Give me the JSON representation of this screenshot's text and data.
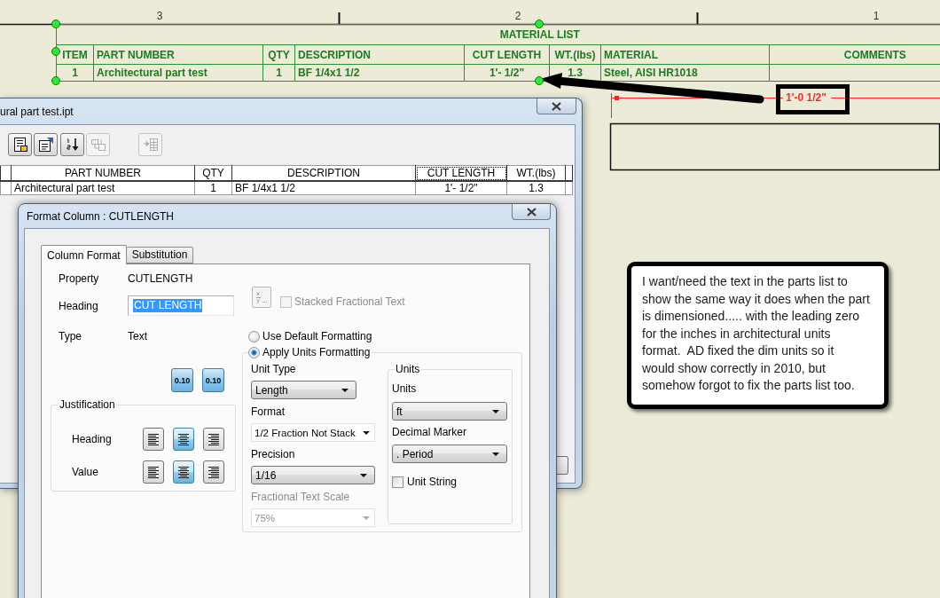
{
  "sheet": {
    "zone_labels": [
      "3",
      "2",
      "1"
    ],
    "material_list": {
      "title": "MATERIAL LIST",
      "columns": [
        "ITEM",
        "PART NUMBER",
        "QTY",
        "DESCRIPTION",
        "CUT LENGTH",
        "WT.(lbs)",
        "MATERIAL",
        "COMMENTS"
      ],
      "rows": [
        [
          "1",
          "Architectural part test",
          "1",
          "BF 1/4x1 1/2",
          "1'- 1/2\"",
          "1.3",
          "Steel, AISI HR1018"
        ]
      ]
    },
    "dimension": {
      "value": "1'-0 1/2\""
    }
  },
  "callout": {
    "text": "I want/need the text in the parts list to\nshow the same way it does when the part\nis dimensioned..... with the leading zero\nfor the inches in architectural units\nformat.  AD fixed the dim units so it\nwould show correctly in 2010, but\nsomehow forgot to fix the parts list too."
  },
  "parts_list_window": {
    "title": "ural part test.ipt",
    "toolbar": [
      {
        "kind": "table",
        "disabled": false
      },
      {
        "kind": "properties",
        "disabled": false
      },
      {
        "kind": "sort",
        "disabled": false
      },
      {
        "kind": "merge",
        "disabled": true
      },
      {
        "kind": "export",
        "disabled": true
      }
    ],
    "table": {
      "columns": [
        {
          "label": "PART NUMBER",
          "selected": false
        },
        {
          "label": "QTY",
          "selected": false
        },
        {
          "label": "DESCRIPTION",
          "selected": false
        },
        {
          "label": "CUT LENGTH",
          "selected": true
        },
        {
          "label": "WT.(lbs)",
          "selected": false
        }
      ],
      "rows": [
        [
          "Architectural part test",
          "1",
          "BF 1/4x1 1/2",
          "1'- 1/2\"",
          "1.3"
        ]
      ]
    }
  },
  "format_column_dialog": {
    "title": "Format Column : CUTLENGTH",
    "tabs": [
      {
        "label": "Column Format",
        "selected": true
      },
      {
        "label": "Substitution",
        "selected": false
      }
    ],
    "fields": [
      {
        "label": "Property",
        "value": "CUTLENGTH",
        "kind": "text"
      },
      {
        "label": "Heading",
        "value": "CUT LENGTH",
        "kind": "input"
      },
      {
        "label": "Type",
        "value": "Text",
        "kind": "text"
      }
    ],
    "precision_buttons": [
      {
        "label": "0.10"
      },
      {
        "label": "0.10"
      }
    ],
    "stacked_fractional_text": {
      "label": "Stacked Fractional Text",
      "checked": false,
      "disabled": true
    },
    "formatting": [
      {
        "label": "Use Default Formatting",
        "selected": false
      },
      {
        "label": "Apply Units Formatting",
        "selected": true
      }
    ],
    "justification": {
      "title": "Justification",
      "rows": [
        {
          "label": "Heading",
          "options": [
            {
              "kind": "left",
              "selected": false
            },
            {
              "kind": "center",
              "selected": true
            },
            {
              "kind": "right",
              "selected": false
            }
          ]
        },
        {
          "label": "Value",
          "options": [
            {
              "kind": "left",
              "selected": false
            },
            {
              "kind": "center",
              "selected": true
            },
            {
              "kind": "right",
              "selected": false
            }
          ]
        }
      ]
    },
    "unit_fields": [
      {
        "label": "Unit Type",
        "value": "Length",
        "kind": "dropdown",
        "disabled": false
      },
      {
        "label": "Format",
        "value": "1/2 Fraction Not Stack",
        "kind": "combo",
        "disabled": false
      },
      {
        "label": "Precision",
        "value": "1/16",
        "kind": "dropdown",
        "disabled": false
      },
      {
        "label": "Fractional Text Scale",
        "value": "75%",
        "kind": "combo",
        "disabled": true
      }
    ],
    "units": {
      "title": "Units",
      "fields": [
        {
          "label": "Units",
          "value": "ft"
        },
        {
          "label": "Decimal Marker",
          "value": ". Period"
        }
      ],
      "unit_string": {
        "label": "Unit String",
        "checked": false
      }
    }
  }
}
